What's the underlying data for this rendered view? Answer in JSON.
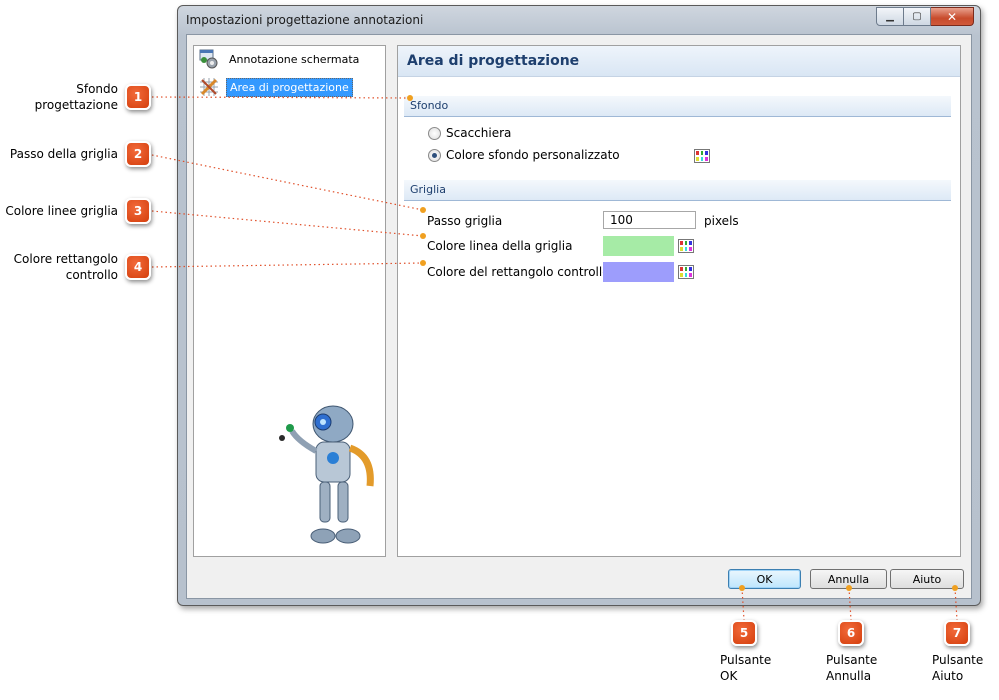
{
  "window": {
    "title": "Impostazioni progettazione annotazioni",
    "controls": [
      "minimize",
      "maximize",
      "close"
    ]
  },
  "nav": {
    "items": [
      {
        "label": "Annotazione schermata",
        "icon": "gear-window-icon",
        "selected": false
      },
      {
        "label": "Area di progettazione",
        "icon": "grid-tools-icon",
        "selected": true
      }
    ]
  },
  "content": {
    "title": "Area di progettazione",
    "sfondo": {
      "header": "Sfondo",
      "options": [
        {
          "label": "Scacchiera",
          "checked": false
        },
        {
          "label": "Colore sfondo personalizzato",
          "checked": true
        }
      ]
    },
    "griglia": {
      "header": "Griglia",
      "passo_label": "Passo griglia",
      "passo_value": "100",
      "passo_unit": "pixels",
      "linea_label": "Colore linea della griglia",
      "linea_color": "#a6eba6",
      "rettangolo_label": "Colore del rettangolo controllo",
      "rettangolo_color": "#9d9dfc"
    }
  },
  "buttons": {
    "ok": "OK",
    "annulla": "Annulla",
    "aiuto": "Aiuto"
  },
  "callouts": [
    {
      "number": "1",
      "text": [
        "Sfondo",
        "progettazione"
      ]
    },
    {
      "number": "2",
      "text": [
        "Passo della griglia"
      ]
    },
    {
      "number": "3",
      "text": [
        "Colore linee griglia"
      ]
    },
    {
      "number": "4",
      "text": [
        "Colore rettangolo",
        "controllo"
      ]
    },
    {
      "number": "5",
      "text": [
        "Pulsante",
        "OK"
      ]
    },
    {
      "number": "6",
      "text": [
        "Pulsante",
        "Annulla"
      ]
    },
    {
      "number": "7",
      "text": [
        "Pulsante",
        "Aiuto"
      ]
    }
  ],
  "colors": {
    "callout": "#e04a14",
    "accent": "#3399ff",
    "leader": "#e0502a"
  }
}
